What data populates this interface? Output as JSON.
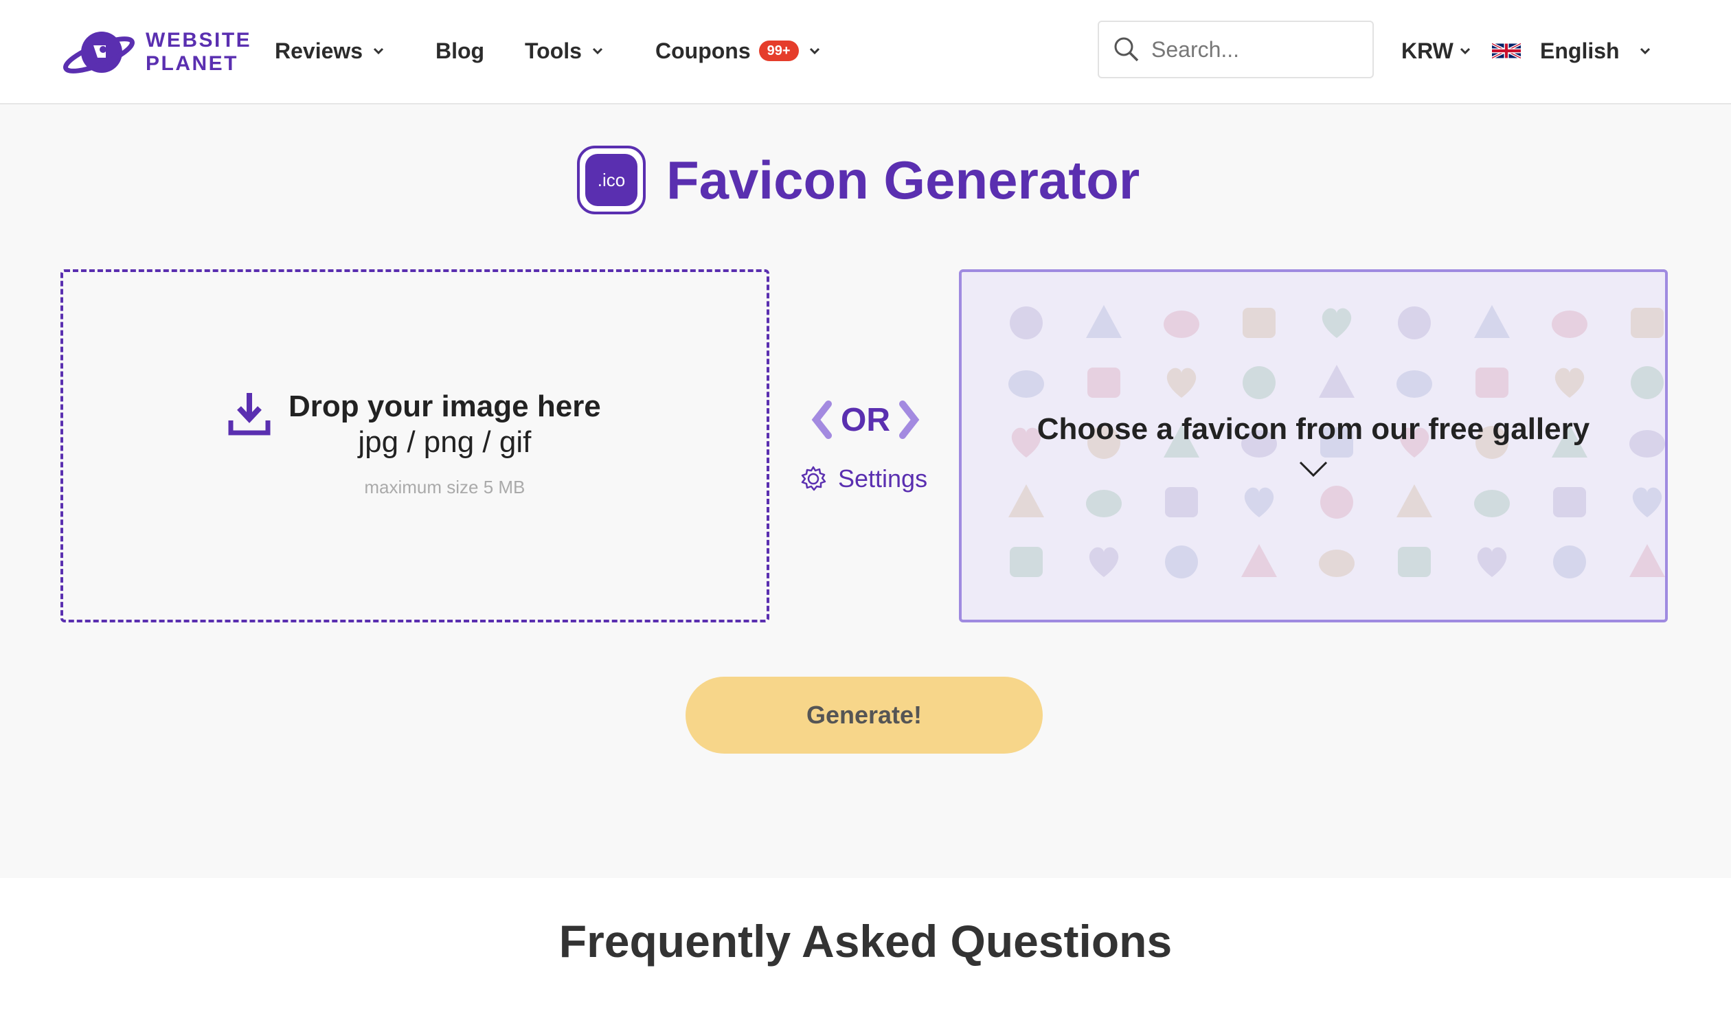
{
  "header": {
    "logo": {
      "line1": "WEBSITE",
      "line2": "PLANET"
    },
    "nav": [
      {
        "label": "Reviews",
        "has_dropdown": true
      },
      {
        "label": "Blog",
        "has_dropdown": false
      },
      {
        "label": "Tools",
        "has_dropdown": true
      },
      {
        "label": "Coupons",
        "badge": "99+",
        "has_dropdown": true
      }
    ],
    "search": {
      "placeholder": "Search...",
      "value": ""
    },
    "currency": "KRW",
    "language": "English"
  },
  "tool": {
    "icon_label": ".ico",
    "title": "Favicon Generator",
    "drop": {
      "title": "Drop your image here",
      "formats": "jpg / png / gif",
      "max": "maximum size 5 MB"
    },
    "or_label": "OR",
    "settings_label": "Settings",
    "gallery_label": "Choose a favicon from our free gallery",
    "gallery_icons": [
      "avocado-icon",
      "bulb-icon",
      "camera-icon",
      "coffee-cup-icon",
      "candy-icon",
      "leaf-icon",
      "laptop-icon",
      "cat-icon",
      "monitor-icon",
      "pineapple-icon",
      "car-icon",
      "microphone-icon",
      "star-icon",
      "wrench-icon",
      "feather-icon",
      "drop-icon",
      "tag-icon",
      "heart-badge-icon",
      "cart-icon",
      "gamepad-icon",
      "box-icon",
      "bag-icon",
      "music-icon",
      "bell-icon",
      "camera-retro-icon",
      "film-icon",
      "plus-icon",
      "stroller-icon",
      "bag-lock-icon",
      "moon-icon",
      "glasses-icon",
      "pizza-icon",
      "radio-icon",
      "drum-icon",
      "donut-icon",
      "heart-icon",
      "flame-icon",
      "shirt-icon",
      "fruit-icon",
      "windmill-icon",
      "gift-icon",
      "snowflake-icon",
      "headphones-icon",
      "plane-icon",
      "apple-icon"
    ],
    "generate_label": "Generate!"
  },
  "faq": {
    "title": "Frequently Asked Questions"
  },
  "colors": {
    "brand": "#5a2fb0",
    "badge": "#e53d2b",
    "generate": "#f7d68a",
    "gallery_bg": "#eeebf8"
  }
}
